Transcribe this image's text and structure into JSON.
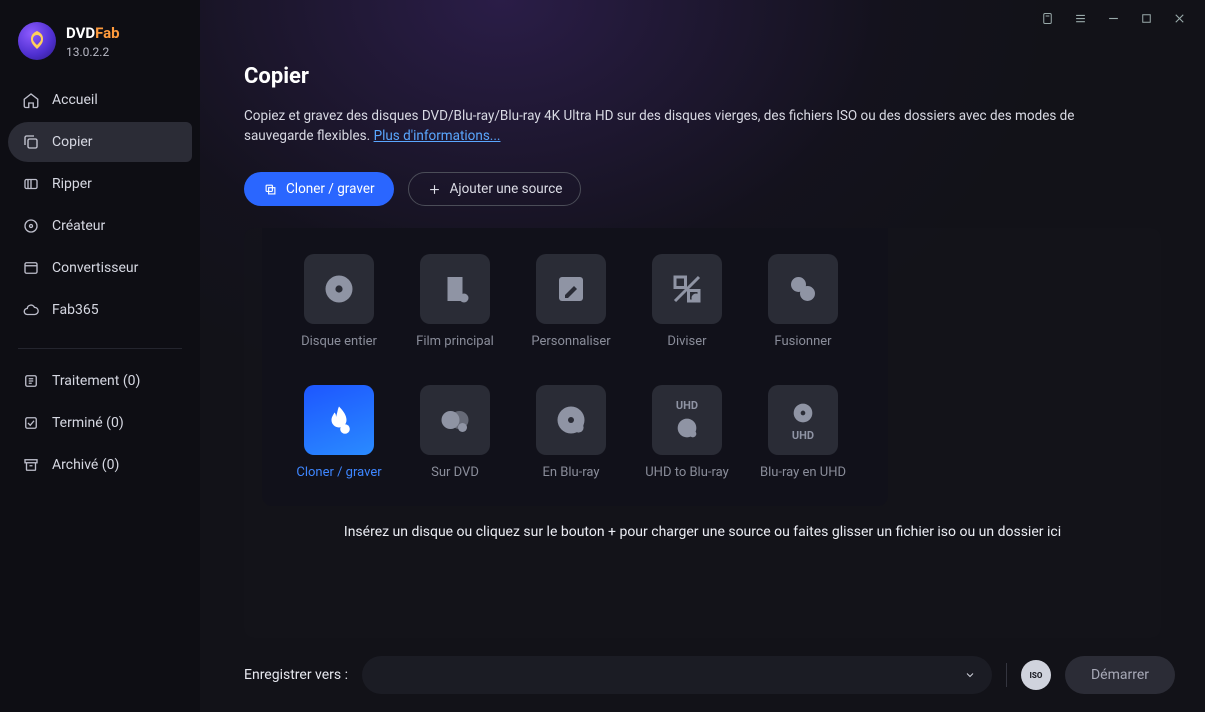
{
  "brand": {
    "name_main": "DVD",
    "name_accent": "Fab",
    "version": "13.0.2.2"
  },
  "sidebar": {
    "items": [
      {
        "label": "Accueil",
        "icon": "home"
      },
      {
        "label": "Copier",
        "icon": "copy",
        "active": true
      },
      {
        "label": "Ripper",
        "icon": "ripper"
      },
      {
        "label": "Créateur",
        "icon": "creator"
      },
      {
        "label": "Convertisseur",
        "icon": "converter"
      },
      {
        "label": "Fab365",
        "icon": "cloud"
      }
    ],
    "queue": [
      {
        "label": "Traitement (0)"
      },
      {
        "label": "Terminé (0)"
      },
      {
        "label": "Archivé (0)"
      }
    ]
  },
  "page": {
    "title": "Copier",
    "description": "Copiez et gravez des disques DVD/Blu-ray/Blu-ray 4K Ultra HD sur des disques vierges, des fichiers ISO ou des dossiers avec des modes de sauvegarde flexibles. ",
    "more_link": "Plus d'informations...",
    "clone_burn": "Cloner / graver",
    "add_source": "Ajouter une source",
    "drop_hint": "Insérez un disque ou cliquez sur le bouton + pour charger une source ou faites glisser un fichier iso ou un dossier ici"
  },
  "modes": [
    {
      "label": "Disque entier",
      "icon": "disc"
    },
    {
      "label": "Film principal",
      "icon": "film"
    },
    {
      "label": "Personnaliser",
      "icon": "edit"
    },
    {
      "label": "Diviser",
      "icon": "split"
    },
    {
      "label": "Fusionner",
      "icon": "merge"
    },
    {
      "label": "Cloner / graver",
      "icon": "flame",
      "active": true
    },
    {
      "label": "Sur DVD",
      "icon": "bd2dvd",
      "text": ""
    },
    {
      "label": "En Blu-ray",
      "icon": "tobd",
      "text": ""
    },
    {
      "label": "UHD to Blu-ray",
      "icon": "uhdbd",
      "text": "UHD"
    },
    {
      "label": "Blu-ray en UHD",
      "icon": "bduhd",
      "text": "UHD"
    }
  ],
  "footer": {
    "save_label": "Enregistrer vers :",
    "iso_label": "ISO",
    "start_label": "Démarrer"
  }
}
